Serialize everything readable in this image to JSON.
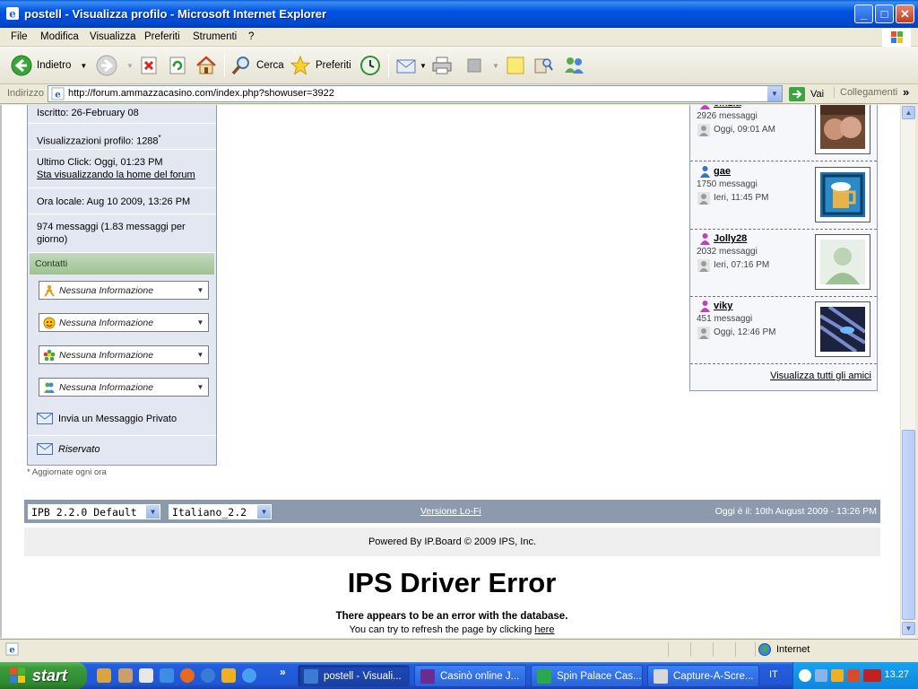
{
  "window": {
    "title": "postell - Visualizza profilo - Microsoft Internet Explorer"
  },
  "menu": [
    "File",
    "Modifica",
    "Visualizza",
    "Preferiti",
    "Strumenti",
    "?"
  ],
  "toolbar": {
    "back": "Indietro",
    "search": "Cerca",
    "favorites": "Preferiti"
  },
  "address": {
    "label": "Indirizzo",
    "url": "http://forum.ammazzacasino.com/index.php?showuser=3922",
    "go": "Vai",
    "links": "Collegamenti"
  },
  "profile": {
    "joined": "Iscritto: 26-February 08",
    "views": "Visualizzazioni profilo: 1288",
    "views_mark": "*",
    "last_click": "Ultimo Click: Oggi, 01:23 PM",
    "last_click_link": "Sta visualizzando la home del forum",
    "local_time": "Ora locale: Aug 10 2009, 13:26 PM",
    "posts": "974 messaggi (1.83 messaggi per giorno)",
    "contacts_header": "Contatti",
    "contacts": [
      {
        "icon": "aim-icon",
        "text": "Nessuna Informazione"
      },
      {
        "icon": "yahoo-icon",
        "text": "Nessuna Informazione"
      },
      {
        "icon": "icq-icon",
        "text": "Nessuna Informazione"
      },
      {
        "icon": "msn-icon",
        "text": "Nessuna Informazione"
      }
    ],
    "pm_link": "Invia un Messaggio Privato",
    "reserved": "Riservato",
    "note": "* Aggiornate ogni ora"
  },
  "friends": {
    "items": [
      {
        "name": "cinzia",
        "gender": "female",
        "posts": "2926 messaggi",
        "seen": "Oggi, 09:01 AM"
      },
      {
        "name": "gae",
        "gender": "male",
        "posts": "1750 messaggi",
        "seen": "Ieri, 11:45 PM"
      },
      {
        "name": "Jolly28",
        "gender": "female",
        "posts": "2032 messaggi",
        "seen": "Ieri, 07:16 PM"
      },
      {
        "name": "viky",
        "gender": "female",
        "posts": "451 messaggi",
        "seen": "Oggi, 12:46 PM"
      }
    ],
    "view_all": "Visualizza tutti gli amici"
  },
  "footer": {
    "skin": "IPB 2.2.0 Default",
    "language": "Italiano_2.2",
    "lofi": "Versione Lo-Fi",
    "today": "Oggi è il: 10th August 2009 - 13:26 PM",
    "powered": "Powered By IP.Board © 2009  IPS, Inc."
  },
  "error": {
    "title": "IPS Driver Error",
    "message": "There appears to be an error with the database.",
    "hint_prefix": "You can try to refresh the page by clicking ",
    "hint_link": "here"
  },
  "status": {
    "zone": "Internet"
  },
  "taskbar": {
    "start": "start",
    "tasks": [
      {
        "label": "postell - Visuali...",
        "active": true,
        "color": "#3a7bd5"
      },
      {
        "label": "Casinò online J...",
        "active": false,
        "color": "#6a2c91"
      },
      {
        "label": "Spin Palace Cas...",
        "active": false,
        "color": "#2aa84a"
      },
      {
        "label": "Capture-A-Scre...",
        "active": false,
        "color": "#d8d8d8"
      }
    ],
    "language": "IT",
    "clock": "13.27"
  },
  "colors": {
    "title_blue": "#0054e3",
    "panel_bg": "#e2e7f1",
    "footer_bar": "#8d9aae",
    "female": "#c040c0",
    "male": "#3a6fd0"
  }
}
